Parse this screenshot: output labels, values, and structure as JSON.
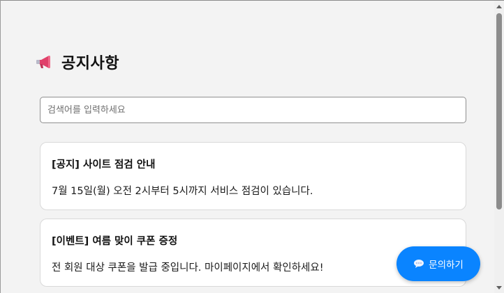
{
  "header": {
    "title": "공지사항",
    "icon": "megaphone-icon"
  },
  "search": {
    "placeholder": "검색어를 입력하세요",
    "value": ""
  },
  "notices": [
    {
      "title": "[공지] 사이트 점검 안내",
      "body": "7월 15일(월) 오전 2시부터 5시까지 서비스 점검이 있습니다."
    },
    {
      "title": "[이벤트] 여름 맞이 쿠폰 증정",
      "body": "전 회원 대상 쿠폰을 발급 중입니다. 마이페이지에서 확인하세요!"
    }
  ],
  "contact_button": {
    "label": "문의하기",
    "icon": "speech-bubble-icon"
  },
  "colors": {
    "accent": "#0a84ff",
    "background": "#f3f3f3",
    "card": "#ffffff"
  }
}
